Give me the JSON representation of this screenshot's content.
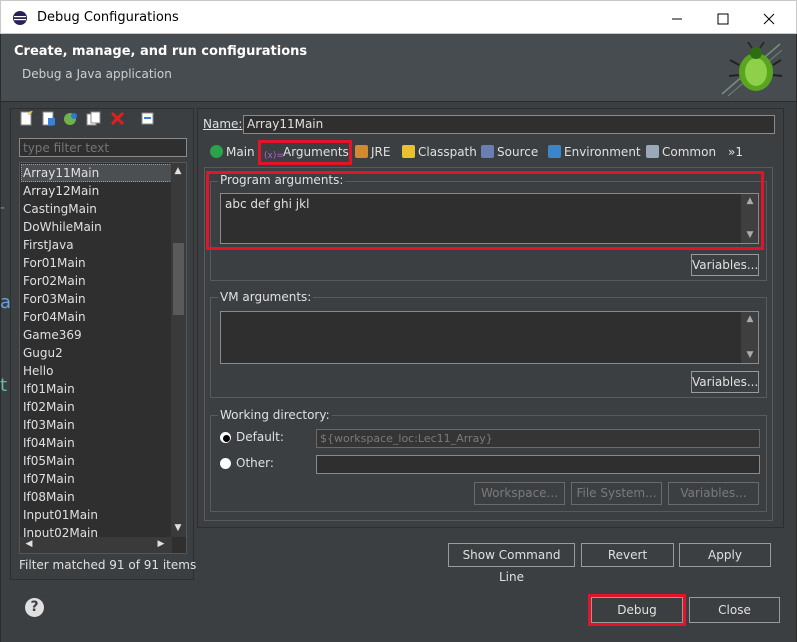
{
  "window": {
    "title": "Debug Configurations",
    "minimize": "—",
    "maximize": "☐",
    "close": "✕"
  },
  "header": {
    "title": "Create, manage, and run configurations",
    "subtitle": "Debug a Java application"
  },
  "left": {
    "filter_placeholder": "type filter text",
    "items": [
      "Array11Main",
      "Array12Main",
      "CastingMain",
      "DoWhileMain",
      "FirstJava",
      "For01Main",
      "For02Main",
      "For03Main",
      "For04Main",
      "Game369",
      "Gugu2",
      "Hello",
      "If01Main",
      "If02Main",
      "If03Main",
      "If04Main",
      "If05Main",
      "If07Main",
      "If08Main",
      "Input01Main",
      "Input02Main"
    ],
    "selected": "Array11Main",
    "status": "Filter matched 91 of 91 items"
  },
  "config": {
    "name_label": "Name:",
    "name_value": "Array11Main",
    "tabs": [
      {
        "label": "Main",
        "icon": "main-tab-icon"
      },
      {
        "label": "Arguments",
        "icon": "arguments-tab-icon"
      },
      {
        "label": "JRE",
        "icon": "jre-tab-icon"
      },
      {
        "label": "Classpath",
        "icon": "classpath-tab-icon"
      },
      {
        "label": "Source",
        "icon": "source-tab-icon"
      },
      {
        "label": "Environment",
        "icon": "environment-tab-icon"
      },
      {
        "label": "Common",
        "icon": "common-tab-icon"
      },
      {
        "label": "»1",
        "icon": "overflow-icon"
      }
    ],
    "selected_tab": "Arguments",
    "program_args_label": "Program arguments:",
    "program_args_value": "abc def ghi jkl",
    "variables_label": "Variables...",
    "vm_args_label": "VM arguments:",
    "vm_args_value": "",
    "working_dir_label": "Working directory:",
    "default_label": "Default:",
    "default_value": "${workspace_loc:Lec11_Array}",
    "other_label": "Other:",
    "other_value": "",
    "workspace_btn": "Workspace...",
    "filesystem_btn": "File System...",
    "variables_btn": "Variables..."
  },
  "actions": {
    "show_command_line": "Show Command Line",
    "revert": "Revert",
    "apply": "Apply",
    "debug": "Debug",
    "close": "Close"
  },
  "colors": {
    "accent_red": "#e3142a",
    "panel_bg": "#3c3f41",
    "header_bg": "#474c50"
  }
}
